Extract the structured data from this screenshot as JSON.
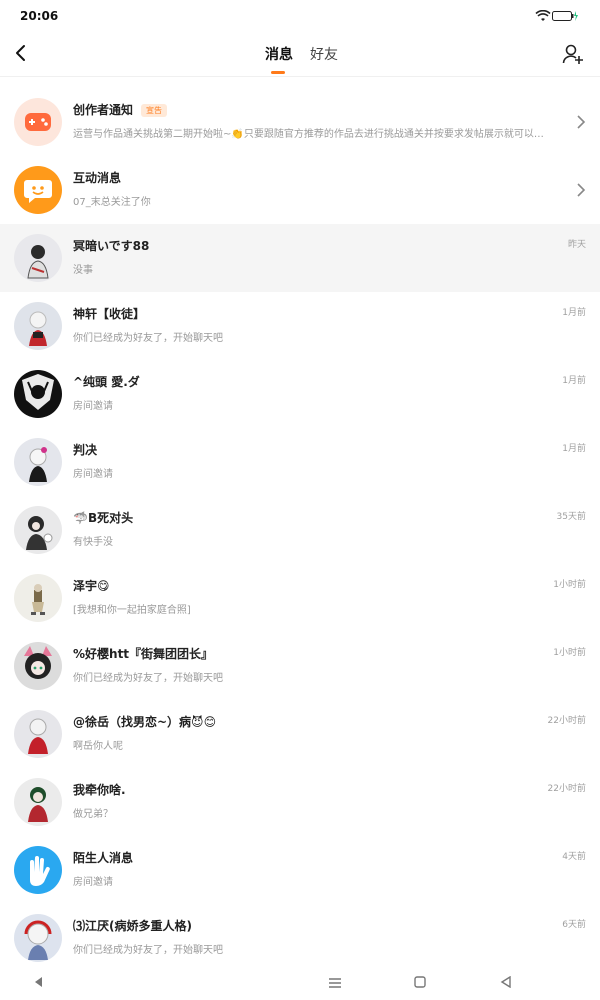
{
  "status": {
    "time": "20:06",
    "icons": [
      "wifi-icon",
      "battery-icon"
    ]
  },
  "header": {
    "tabs": [
      {
        "label": "消息",
        "active": true
      },
      {
        "label": "好友",
        "active": false
      }
    ],
    "accent": "#ff7a1a"
  },
  "messages": [
    {
      "title": "创作者通知",
      "tag": "宣告",
      "subtitle": "运营与作品通关挑战第二期开始啦~👏只要跟随官方推荐的作品去进行挑战通关并按要求发帖展示就可以…",
      "time": "",
      "chevron": true
    },
    {
      "title": "互动消息",
      "subtitle": "07_末总关注了你",
      "time": "",
      "chevron": true
    },
    {
      "title": "冥暗いです88",
      "subtitle": "没事",
      "time": "昨天",
      "chevron": false
    },
    {
      "title": "神轩【收徒】",
      "subtitle": "你们已经成为好友了，开始聊天吧",
      "time": "1月前",
      "chevron": false
    },
    {
      "title": "^纯頭 愛.ダ",
      "subtitle": "房间邀请",
      "time": "1月前",
      "chevron": false
    },
    {
      "title": "判决",
      "subtitle": "房间邀请",
      "time": "1月前",
      "chevron": false
    },
    {
      "title": "🦈B死对头",
      "subtitle": "有快手没",
      "time": "35天前",
      "chevron": false
    },
    {
      "title": "泽宇😋",
      "subtitle": "[我想和你一起拍家庭合照]",
      "time": "1小时前",
      "chevron": false
    },
    {
      "title": "%好樱htt『街舞团团长』",
      "subtitle": "你们已经成为好友了，开始聊天吧",
      "time": "1小时前",
      "chevron": false
    },
    {
      "title": "@徐岳（找男恋~）病😈😊",
      "subtitle": "啊岳你人呢",
      "time": "22小时前",
      "chevron": false
    },
    {
      "title": "我牵你啥.",
      "subtitle": "做兄弟？",
      "time": "22小时前",
      "chevron": false
    },
    {
      "title": "陌生人消息",
      "subtitle": "房间邀请",
      "time": "4天前",
      "chevron": false
    },
    {
      "title": "⑶江厌(病娇多重人格)",
      "subtitle": "你们已经成为好友了，开始聊天吧",
      "time": "6天前",
      "chevron": false
    }
  ]
}
